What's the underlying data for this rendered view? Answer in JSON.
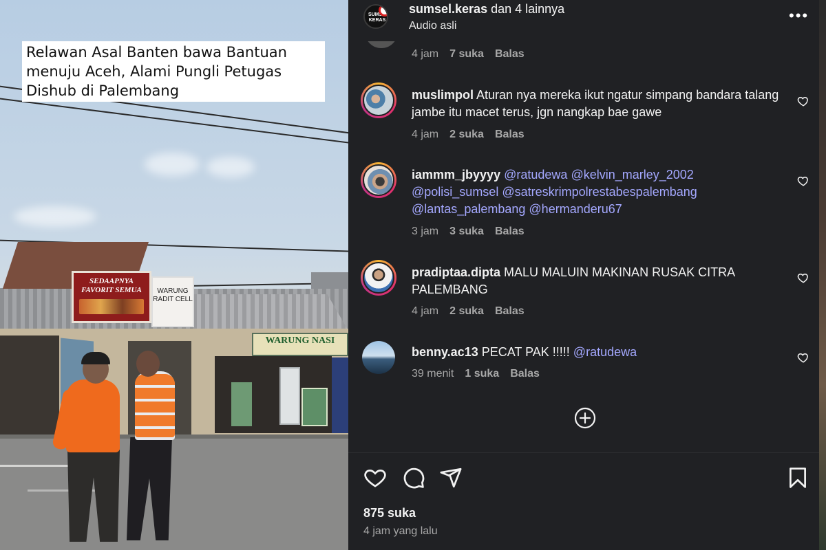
{
  "video": {
    "caption": "Relawan Asal Banten bawa Bantuan menuju Aceh, Alami Pungli Petugas Dishub di Palembang",
    "signs": {
      "red_sign": "SEDAAPNYA FAVORIT SEMUA",
      "white_sign": "WARUNG RADIT CELL",
      "green_sign": "WARUNG NASI"
    }
  },
  "header": {
    "username": "sumsel.keras",
    "others": "dan 4 lainnya",
    "audio": "Audio asli",
    "more_icon": "more-horizontal-icon",
    "avatar_text": "SUMSEL KERAS"
  },
  "comments": [
    {
      "time": "4 jam",
      "likes": "7 suka",
      "reply": "Balas",
      "partial": true
    },
    {
      "username": "muslimpol",
      "text": "Aturan nya mereka ikut ngatur simpang bandara talang jambe itu macet terus, jgn nangkap bae gawe",
      "time": "4 jam",
      "likes": "2 suka",
      "reply": "Balas"
    },
    {
      "username": "iammm_jbyyyy",
      "mentions": [
        "@ratudewa",
        "@kelvin_marley_2002",
        "@polisi_sumsel",
        "@satreskrimpolrestabespalembang",
        "@lantas_palembang",
        "@hermanderu67"
      ],
      "time": "3 jam",
      "likes": "3 suka",
      "reply": "Balas"
    },
    {
      "username": "pradiptaa.dipta",
      "text": "MALU MALUIN MAKINAN RUSAK CITRA PALEMBANG",
      "time": "4 jam",
      "likes": "2 suka",
      "reply": "Balas"
    },
    {
      "username": "benny.ac13",
      "text": "PECAT PAK !!!!!",
      "mention": "@ratudewa",
      "time": "39 menit",
      "likes": "1 suka",
      "reply": "Balas"
    }
  ],
  "footer": {
    "likes_total": "875 suka",
    "time_ago": "4 jam yang lalu",
    "icons": [
      "heart-icon",
      "comment-icon",
      "share-icon",
      "bookmark-icon"
    ]
  },
  "colors": {
    "panel_bg": "#202124",
    "mention": "#a4a8ff",
    "muted": "#a8a8a8"
  }
}
